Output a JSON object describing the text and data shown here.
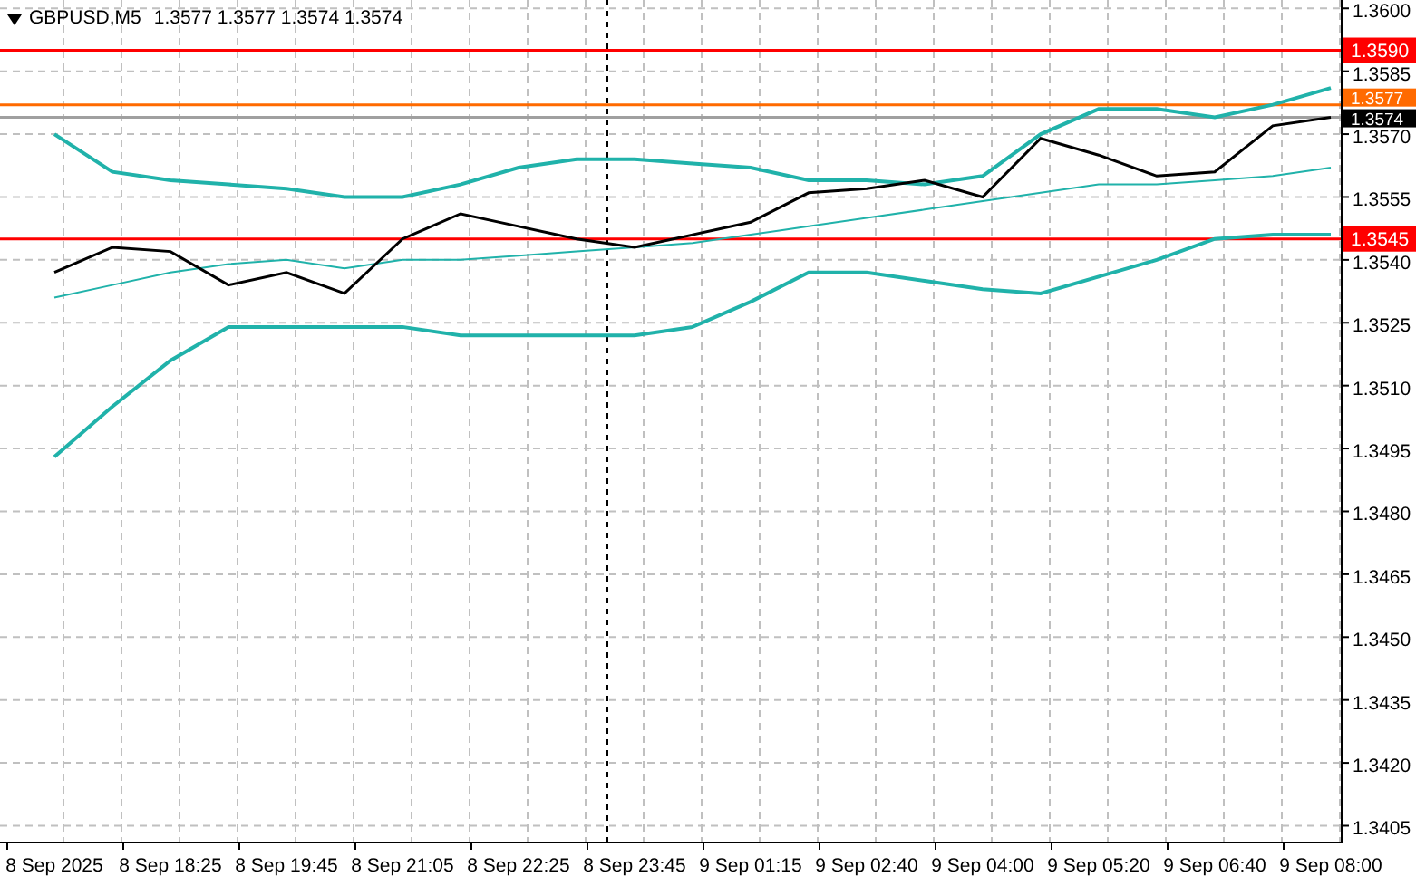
{
  "header": {
    "symbol": "GBPUSD,M5",
    "quotes": "1.3577 1.3577 1.3574 1.3574"
  },
  "price_tags": [
    {
      "kind": "level",
      "price": "1.3590",
      "color": "#ff0000"
    },
    {
      "kind": "ask",
      "price": "1.3577",
      "color": "#ff6a00"
    },
    {
      "kind": "bid",
      "price": "1.3574",
      "color": "#000000"
    },
    {
      "kind": "level",
      "price": "1.3545",
      "color": "#ff0000"
    }
  ],
  "chart_data": {
    "type": "line",
    "grid": true,
    "categories": [
      "8 Sep 2025",
      null,
      "8 Sep 18:25",
      null,
      "8 Sep 19:45",
      null,
      "8 Sep 21:05",
      null,
      "8 Sep 22:25",
      null,
      "8 Sep 23:45",
      null,
      "9 Sep 01:15",
      null,
      "9 Sep 02:40",
      null,
      "9 Sep 04:00",
      null,
      "9 Sep 05:20",
      null,
      "9 Sep 06:40",
      null,
      "9 Sep 08:00"
    ],
    "series": [
      {
        "color": "#20b2aa",
        "values": [
          1.357,
          1.3561,
          1.3559,
          1.3558,
          1.3557,
          1.3555,
          1.3555,
          1.3558,
          1.3562,
          1.3564,
          1.3564,
          1.3563,
          1.3562,
          1.3559,
          1.3559,
          1.3558,
          1.356,
          1.357,
          1.3576,
          1.3576,
          1.3574,
          1.3577,
          1.3581
        ]
      },
      {
        "color": "#20b2aa",
        "values": [
          1.3531,
          1.3534,
          1.3537,
          1.3539,
          1.354,
          1.3538,
          1.354,
          1.354,
          1.3541,
          1.3542,
          1.3543,
          1.3544,
          1.3546,
          1.3548,
          1.355,
          1.3552,
          1.3554,
          1.3556,
          1.3558,
          1.3558,
          1.3559,
          1.356,
          1.3562
        ]
      },
      {
        "color": "#20b2aa",
        "values": [
          1.3493,
          1.3505,
          1.3516,
          1.3524,
          1.3524,
          1.3524,
          1.3524,
          1.3522,
          1.3522,
          1.3522,
          1.3522,
          1.3524,
          1.353,
          1.3537,
          1.3537,
          1.3535,
          1.3533,
          1.3532,
          1.3536,
          1.354,
          1.3545,
          1.3546,
          1.3546
        ]
      },
      {
        "color": "#000000",
        "values": [
          1.3537,
          1.3543,
          1.3542,
          1.3534,
          1.3537,
          1.3532,
          1.3545,
          1.3551,
          1.3548,
          1.3545,
          1.3543,
          1.3546,
          1.3549,
          1.3556,
          1.3557,
          1.3559,
          1.3555,
          1.3569,
          1.3565,
          1.356,
          1.3561,
          1.3572,
          1.3574
        ]
      }
    ],
    "ylim": [
      1.3401,
      1.3602
    ],
    "yticks": [
      {
        "value": 1.36,
        "label": "1.3600"
      },
      {
        "value": 1.3585,
        "label": "1.3585"
      },
      {
        "value": 1.357,
        "label": "1.3570"
      },
      {
        "value": 1.3555,
        "label": "1.3555"
      },
      {
        "value": 1.354,
        "label": "1.3540"
      },
      {
        "value": 1.3525,
        "label": "1.3525"
      },
      {
        "value": 1.351,
        "label": "1.3510"
      },
      {
        "value": 1.3495,
        "label": "1.3495"
      },
      {
        "value": 1.348,
        "label": "1.3480"
      },
      {
        "value": 1.3465,
        "label": "1.3465"
      },
      {
        "value": 1.345,
        "label": "1.3450"
      },
      {
        "value": 1.3435,
        "label": "1.3435"
      },
      {
        "value": 1.342,
        "label": "1.3420"
      },
      {
        "value": 1.3405,
        "label": "1.3405"
      }
    ],
    "ref_lines": [
      {
        "axis": "y",
        "value": 1.359,
        "color": "#ff0000"
      },
      {
        "axis": "y",
        "value": 1.3577,
        "color": "#ff6a00"
      },
      {
        "axis": "y",
        "value": 1.3574,
        "color": "#a0a0a0"
      },
      {
        "axis": "y",
        "value": 1.3545,
        "color": "#ff0000"
      }
    ]
  }
}
